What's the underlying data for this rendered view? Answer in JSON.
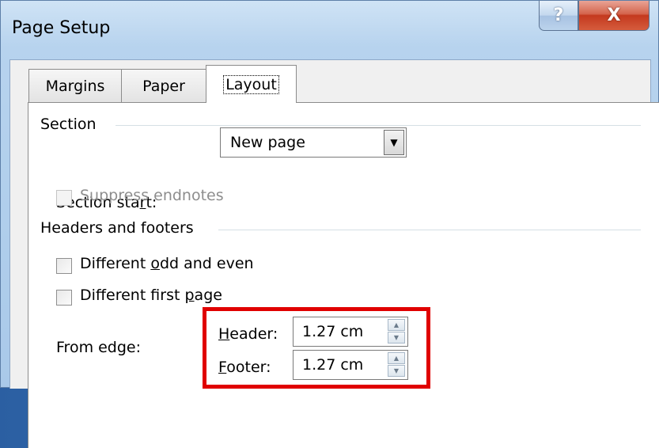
{
  "window": {
    "title": "Page Setup",
    "help_glyph": "?",
    "close_glyph": "X"
  },
  "tabs": [
    {
      "label": "Margins",
      "active": false
    },
    {
      "label": "Paper",
      "active": false
    },
    {
      "label": "Layout",
      "active": true
    }
  ],
  "section": {
    "title": "Section",
    "section_start_label_pre": "Section sta",
    "section_start_label_u": "r",
    "section_start_label_post": "t:",
    "section_start_value": "New page",
    "suppress_endnotes_label": "Suppress endnotes",
    "suppress_endnotes_checked": false,
    "suppress_endnotes_enabled": false
  },
  "headers_footers": {
    "title": "Headers and footers",
    "odd_even_pre": "Different ",
    "odd_even_u": "o",
    "odd_even_post": "dd and even",
    "odd_even_checked": false,
    "first_page_pre": "Different first ",
    "first_page_u": "p",
    "first_page_post": "age",
    "first_page_checked": false,
    "from_edge_label": "From edge:",
    "header_label_u": "H",
    "header_label_rest": "eader:",
    "header_value": "1.27 cm",
    "footer_label_u": "F",
    "footer_label_rest": "ooter:",
    "footer_value": "1.27 cm"
  },
  "icons": {
    "dropdown": "chevron-down-icon",
    "spin_up": "spin-up-icon",
    "spin_down": "spin-down-icon"
  },
  "colors": {
    "highlight": "#e00000",
    "close_button": "#c4391e"
  }
}
